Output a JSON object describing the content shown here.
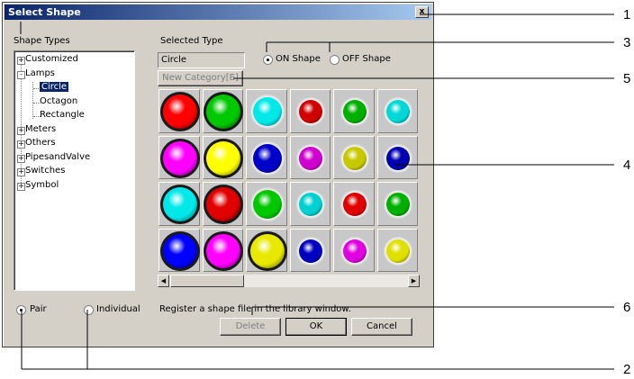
{
  "dialog": {
    "title": "Select Shape",
    "close_glyph": "x",
    "shape_types_label": "Shape Types",
    "selected_type_label": "Selected Type",
    "selected_type_value": "Circle",
    "on_shape_label": "ON Shape",
    "off_shape_label": "OFF Shape",
    "new_category_label": "New Category[E]",
    "pair_label": "Pair",
    "individual_label": "Individual",
    "register_text": "Register a shape file in the library window.",
    "delete_label": "Delete",
    "ok_label": "OK",
    "cancel_label": "Cancel"
  },
  "tree": [
    {
      "label": "Customized",
      "toggle": "+"
    },
    {
      "label": "Lamps",
      "toggle": "-"
    },
    {
      "label": "Circle",
      "selected": true
    },
    {
      "label": "Octagon"
    },
    {
      "label": "Rectangle"
    },
    {
      "label": "Meters",
      "toggle": "+"
    },
    {
      "label": "Others",
      "toggle": "+"
    },
    {
      "label": "PipesandValve",
      "toggle": "+"
    },
    {
      "label": "Switches",
      "toggle": "+"
    },
    {
      "label": "Symbol",
      "toggle": "+"
    }
  ],
  "lamps": [
    [
      "#ff0000",
      "#00c800",
      "#00e8e8",
      "#d00000",
      "#00b000",
      "#00d8d8"
    ],
    [
      "#ff00ff",
      "#ffff00",
      "#0000c8",
      "#d000d0",
      "#c8c800",
      "#0000b0"
    ],
    [
      "#00e8e8",
      "#e00000",
      "#00c800",
      "#00d0d0",
      "#e00000",
      "#00b000"
    ],
    [
      "#0000ff",
      "#ff00ff",
      "#e8e800",
      "#0000c0",
      "#e000e0",
      "#e0e000"
    ]
  ],
  "callouts": {
    "c1": "1",
    "c2": "2",
    "c3": "3",
    "c4": "4",
    "c5": "5",
    "c6": "6"
  }
}
